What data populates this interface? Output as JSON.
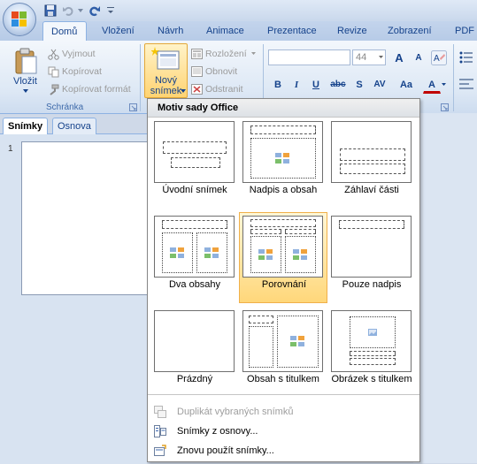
{
  "tabs": [
    "Domů",
    "Vložení",
    "Návrh",
    "Animace",
    "Prezentace",
    "Revize",
    "Zobrazení",
    "PDF"
  ],
  "clipboard": {
    "paste_label": "Vložit",
    "cut_label": "Vyjmout",
    "copy_label": "Kopírovat",
    "format_painter_label": "Kopírovat formát",
    "group_label": "Schránka"
  },
  "slides_group": {
    "new_slide_label_line1": "Nový",
    "new_slide_label_line2": "snímek",
    "layout_label": "Rozložení",
    "reset_label": "Obnovit",
    "delete_label": "Odstranit"
  },
  "font": {
    "font_name": "",
    "font_size": "44",
    "bold": "B",
    "italic": "I",
    "underline": "U",
    "strike": "abc",
    "shadow": "S",
    "spacing": "AV",
    "case": "Aa",
    "color": "A",
    "grow": "A",
    "shrink": "A"
  },
  "pane_tabs": {
    "slides": "Snímky",
    "outline": "Osnova"
  },
  "slide_number": "1",
  "gallery": {
    "header": "Motiv sady Office",
    "layouts": [
      {
        "label": "Úvodní snímek"
      },
      {
        "label": "Nadpis a obsah"
      },
      {
        "label": "Záhlaví části"
      },
      {
        "label": "Dva obsahy"
      },
      {
        "label": "Porovnání"
      },
      {
        "label": "Pouze nadpis"
      },
      {
        "label": "Prázdný"
      },
      {
        "label": "Obsah s titulkem"
      },
      {
        "label": "Obrázek s titulkem"
      }
    ],
    "selected_index": 4
  },
  "menu": {
    "duplicate": "Duplikát vybraných snímků",
    "from_outline": "Snímky z osnovy...",
    "reuse": "Znovu použít snímky..."
  },
  "colors": {
    "ribbon_text": "#15428b",
    "selected_fill": "#ffd77a",
    "accent_border": "#8db2e3"
  }
}
